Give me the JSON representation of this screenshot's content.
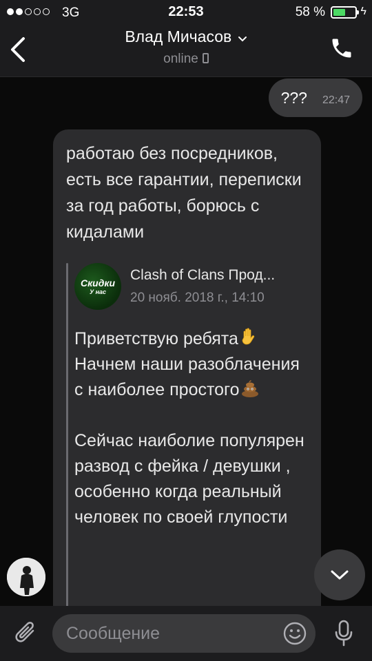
{
  "status_bar": {
    "carrier": "3G",
    "time": "22:53",
    "battery_percent": "58 %",
    "battery_level": 0.58
  },
  "header": {
    "title": "Влад Мичасов",
    "subtitle": "online"
  },
  "messages": {
    "outgoing": {
      "text": "???",
      "time": "22:47"
    },
    "incoming": {
      "text": "работаю без посредников, есть все гарантии, переписки за год работы, борюсь с кидалами",
      "forwarded": {
        "avatar_line1": "Скидки",
        "avatar_line2": "У нас",
        "source_name": "Clash of Clans Прод...",
        "date": "20 нояб. 2018 г., 14:10",
        "text_part1": "Приветствую ребята",
        "text_part2": "Начнем наши разоблачения с наиболее простого",
        "text_part3": "Сейчас наиболие популярен развод с фейка / девушки , особенно когда реальный человек по своей глупости"
      }
    }
  },
  "composer": {
    "placeholder": "Сообщение"
  },
  "icons": {
    "back": "chevron-left-icon",
    "call": "phone-icon",
    "attach": "paperclip-icon",
    "emoji": "smile-icon",
    "mic": "microphone-icon",
    "scroll": "chevron-down-icon",
    "hand": "raised-hand-emoji",
    "poop": "pile-of-poo-emoji"
  },
  "colors": {
    "background": "#0a0a0a",
    "bar": "#1c1c1e",
    "bubble_in": "#2c2c2e",
    "bubble_out": "#3a3a3c",
    "battery": "#4cd964"
  }
}
